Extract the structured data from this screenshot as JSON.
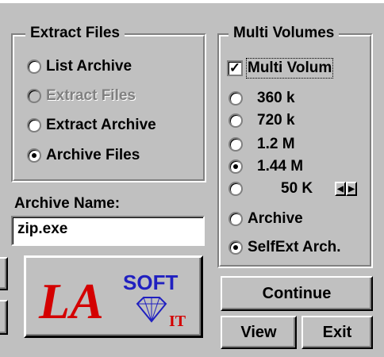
{
  "extract_group": {
    "title": "Extract Files",
    "options": [
      {
        "label": "List Archive",
        "selected": false,
        "enabled": true
      },
      {
        "label": "Extract Files",
        "selected": false,
        "enabled": false
      },
      {
        "label": "Extract Archive",
        "selected": false,
        "enabled": true
      },
      {
        "label": "Archive Files",
        "selected": true,
        "enabled": true
      }
    ]
  },
  "multi_group": {
    "title": "Multi Volumes",
    "checkbox_label": "Multi Volum",
    "checkbox_checked": true,
    "check_glyph": "✓",
    "sizes": [
      {
        "label": "360 k",
        "selected": false
      },
      {
        "label": "720 k",
        "selected": false
      },
      {
        "label": "1.2 M",
        "selected": false
      },
      {
        "label": "1.44 M",
        "selected": true
      },
      {
        "label": "50 K",
        "selected": false
      }
    ],
    "spin_left": "◀",
    "spin_right": "▶",
    "mode_options": [
      {
        "label": "Archive",
        "selected": false
      },
      {
        "label": "SelfExt Arch.",
        "selected": true
      }
    ]
  },
  "archive_name": {
    "label": "Archive Name:",
    "value": "zip.exe"
  },
  "logo": {
    "monogram": "LA",
    "soft": "SOFT",
    "it": "IT"
  },
  "buttons": {
    "continue": "Continue",
    "view": "View",
    "exit": "Exit"
  },
  "colors": {
    "face": "#c0c0c0",
    "logo_red": "#d40000",
    "logo_blue": "#2020c0"
  }
}
